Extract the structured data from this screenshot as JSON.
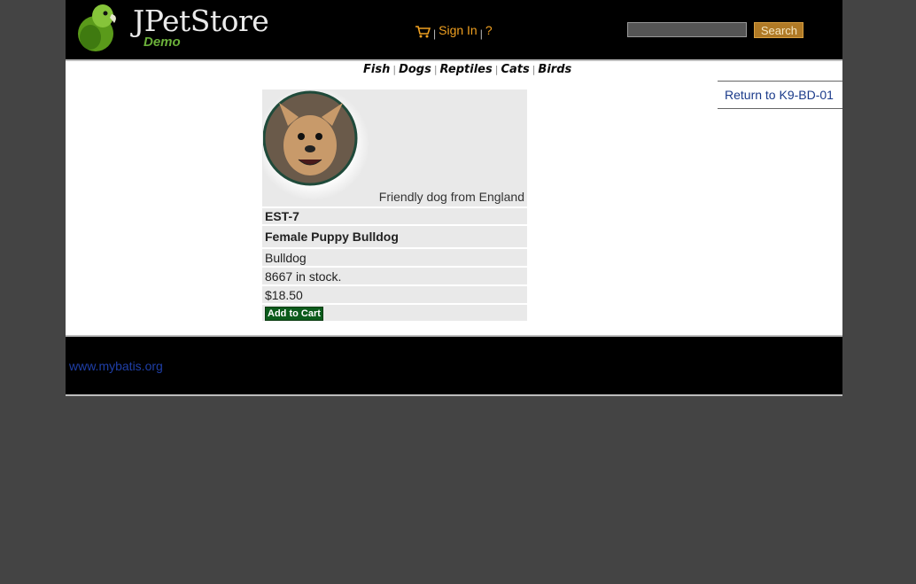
{
  "header": {
    "logo_text": "JPetStore",
    "logo_sub": "Demo",
    "sign_in": "Sign In",
    "separator": "|",
    "help": "?",
    "search_button": "Search",
    "search_value": ""
  },
  "quicklinks": [
    "Fish",
    "Dogs",
    "Reptiles",
    "Cats",
    "Birds"
  ],
  "return_link": "Return to K9-BD-01",
  "item": {
    "image_description": "Friendly dog from England",
    "id": "EST-7",
    "name": "Female Puppy Bulldog",
    "product": "Bulldog",
    "stock": "8667 in stock.",
    "price": "$18.50",
    "add_to_cart": "Add to Cart"
  },
  "footer": {
    "link": "www.mybatis.org"
  },
  "colors": {
    "accent": "#f0a020",
    "header_bg": "#000000",
    "page_bg": "#444444",
    "cart_button": "#0b5b1b"
  }
}
